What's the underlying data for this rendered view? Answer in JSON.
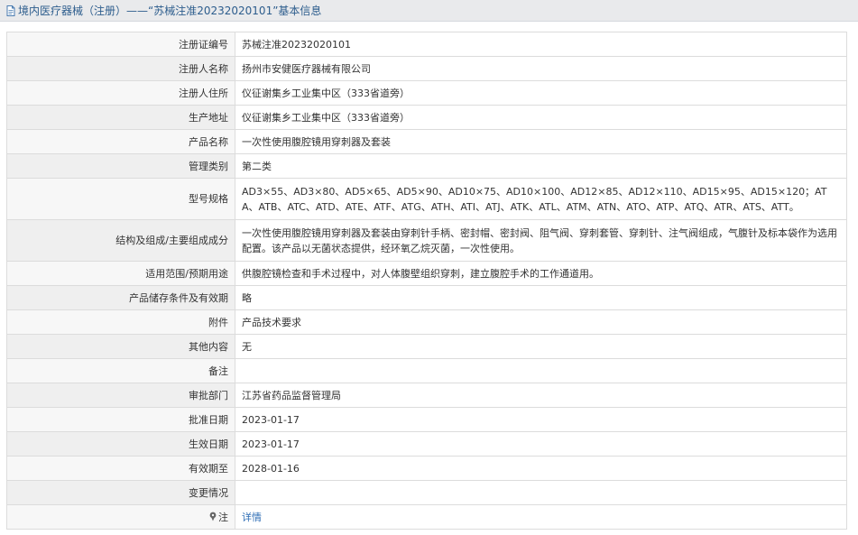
{
  "header": {
    "title": "境内医疗器械（注册）——“苏械注准20232020101”基本信息"
  },
  "rows": [
    {
      "label": "注册证编号",
      "value": "苏械注准20232020101"
    },
    {
      "label": "注册人名称",
      "value": "扬州市安健医疗器械有限公司"
    },
    {
      "label": "注册人住所",
      "value": "仪征谢集乡工业集中区（333省道旁）"
    },
    {
      "label": "生产地址",
      "value": "仪征谢集乡工业集中区（333省道旁）"
    },
    {
      "label": "产品名称",
      "value": "一次性使用腹腔镜用穿刺器及套装"
    },
    {
      "label": "管理类别",
      "value": "第二类"
    },
    {
      "label": "型号规格",
      "value": "AD3×55、AD3×80、AD5×65、AD5×90、AD10×75、AD10×100、AD12×85、AD12×110、AD15×95、AD15×120；ATA、ATB、ATC、ATD、ATE、ATF、ATG、ATH、ATI、ATJ、ATK、ATL、ATM、ATN、ATO、ATP、ATQ、ATR、ATS、ATT。"
    },
    {
      "label": "结构及组成/主要组成成分",
      "value": "一次性使用腹腔镜用穿刺器及套装由穿刺针手柄、密封帽、密封阀、阻气阀、穿刺套管、穿刺针、注气阀组成，气腹针及标本袋作为选用配置。该产品以无菌状态提供，经环氧乙烷灭菌，一次性使用。"
    },
    {
      "label": "适用范围/预期用途",
      "value": "供腹腔镜检查和手术过程中，对人体腹壁组织穿刺，建立腹腔手术的工作通道用。"
    },
    {
      "label": "产品储存条件及有效期",
      "value": "略"
    },
    {
      "label": "附件",
      "value": "产品技术要求"
    },
    {
      "label": "其他内容",
      "value": "无"
    },
    {
      "label": "备注",
      "value": ""
    },
    {
      "label": "审批部门",
      "value": "江苏省药品监督管理局"
    },
    {
      "label": "批准日期",
      "value": "2023-01-17"
    },
    {
      "label": "生效日期",
      "value": "2023-01-17"
    },
    {
      "label": "有效期至",
      "value": "2028-01-16"
    },
    {
      "label": "变更情况",
      "value": ""
    }
  ],
  "note_row": {
    "label": "注",
    "link_text": "详情",
    "icon": "pin-icon"
  }
}
